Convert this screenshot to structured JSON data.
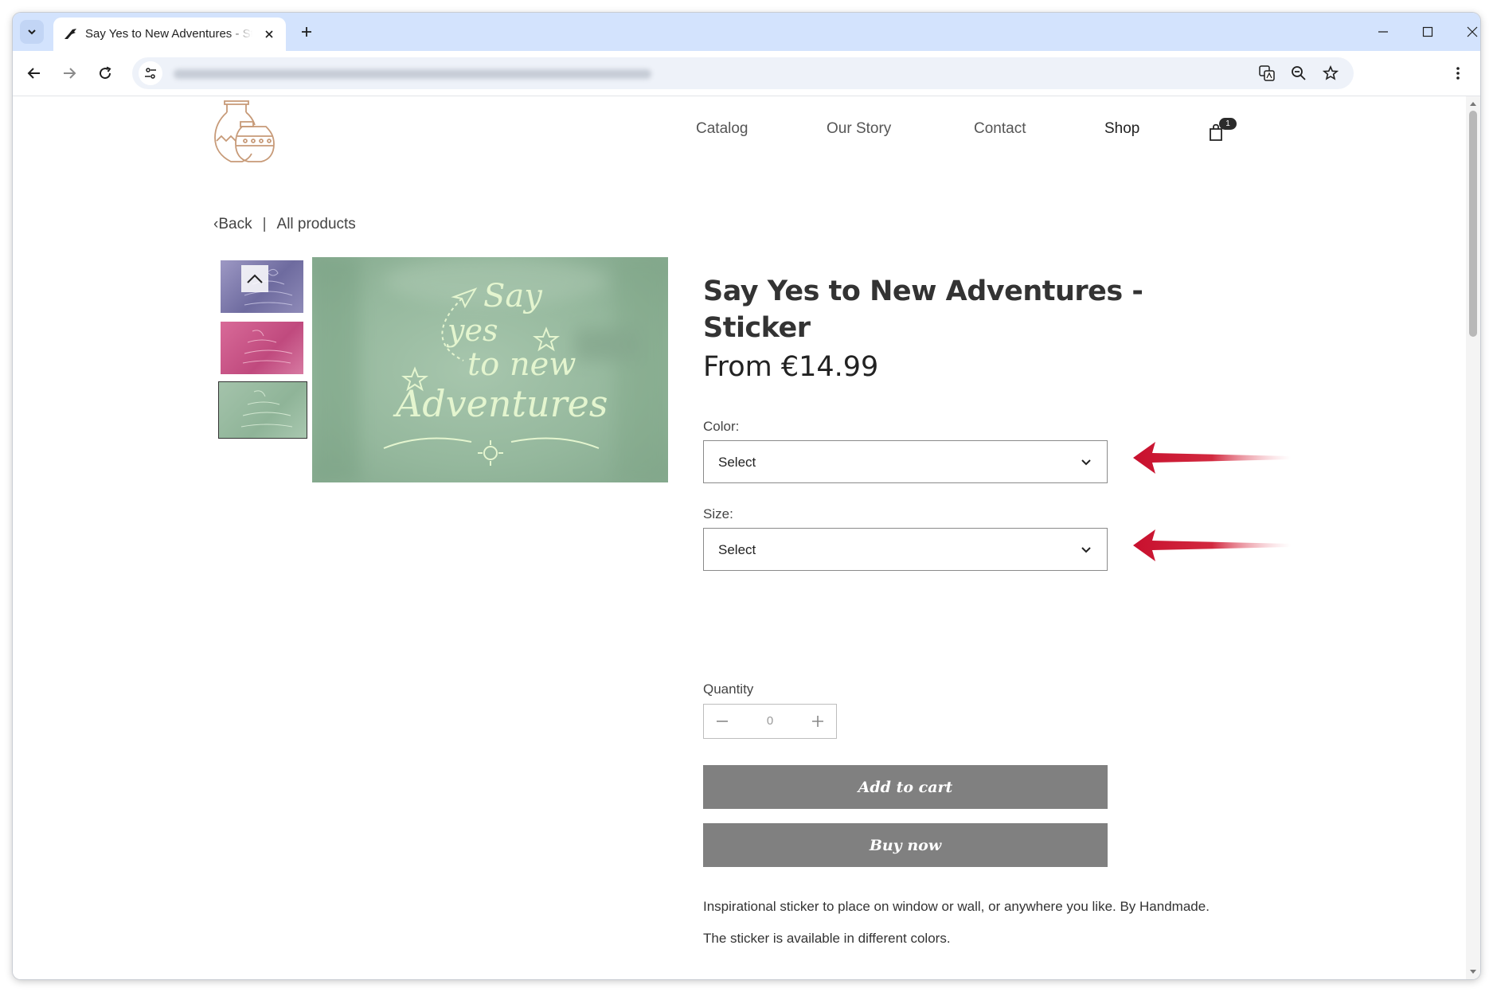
{
  "browser": {
    "tab_title": "Say Yes to New Adventures - Sticker",
    "tab_close_icon": "close-icon",
    "new_tab_icon": "plus-icon"
  },
  "nav": {
    "items": [
      {
        "label": "Catalog"
      },
      {
        "label": "Our Story"
      },
      {
        "label": "Contact"
      },
      {
        "label": "Shop"
      }
    ],
    "cart_count": "1"
  },
  "breadcrumb": {
    "back": "‹Back",
    "separator": "|",
    "all_products": "All products"
  },
  "product": {
    "title": "Say Yes to New Adventures - Sticker",
    "price": "From €14.99",
    "image_lettering": [
      "Say",
      "yes",
      "to new",
      "Adventures"
    ],
    "color_label": "Color:",
    "color_value": "Select",
    "size_label": "Size:",
    "size_value": "Select",
    "quantity_label": "Quantity",
    "quantity_value": "0",
    "add_to_cart": "Add to cart",
    "buy_now": "Buy now",
    "description": [
      "Inspirational sticker to place on window or wall, or anywhere you like. By Handmade.",
      "The sticker is available in different colors."
    ]
  },
  "colors": {
    "accent_arrow": "#c8102e",
    "button_bg": "#808080",
    "tabbar_bg": "#d3e3fd"
  }
}
